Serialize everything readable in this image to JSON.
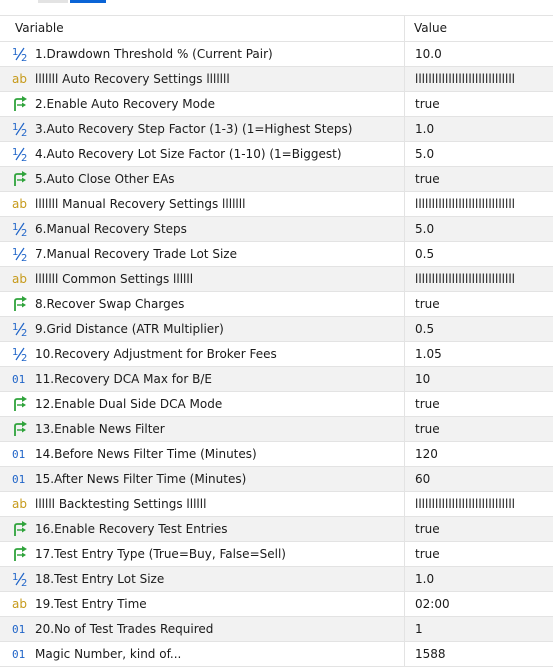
{
  "header": {
    "variable": "Variable",
    "value": "Value"
  },
  "colors": {
    "num_icon": "#1f64c8",
    "bool_icon": "#2fa33b",
    "text_icon": "#c69a1a",
    "int_icon": "#1f64c8",
    "tab_accent": "#0a64d6"
  },
  "rows": [
    {
      "icon": "double-icon",
      "name": "1.Drawdown Threshold % (Current Pair)",
      "value": "10.0"
    },
    {
      "icon": "string-icon",
      "name": "lllllll Auto Recovery Settings lllllll",
      "value": "llllllllllllllllllllllllllllll"
    },
    {
      "icon": "bool-icon",
      "name": "2.Enable Auto Recovery Mode",
      "value": "true"
    },
    {
      "icon": "double-icon",
      "name": "3.Auto Recovery Step Factor (1-3) (1=Highest Steps)",
      "value": "1.0"
    },
    {
      "icon": "double-icon",
      "name": "4.Auto Recovery Lot Size Factor (1-10) (1=Biggest)",
      "value": "5.0"
    },
    {
      "icon": "bool-icon",
      "name": "5.Auto Close Other EAs",
      "value": "true"
    },
    {
      "icon": "string-icon",
      "name": "lllllll Manual Recovery Settings lllllll",
      "value": "llllllllllllllllllllllllllllll"
    },
    {
      "icon": "double-icon",
      "name": "6.Manual Recovery Steps",
      "value": "5.0"
    },
    {
      "icon": "double-icon",
      "name": "7.Manual Recovery Trade Lot Size",
      "value": "0.5"
    },
    {
      "icon": "string-icon",
      "name": "lllllll Common Settings llllll",
      "value": "llllllllllllllllllllllllllllll"
    },
    {
      "icon": "bool-icon",
      "name": "8.Recover Swap Charges",
      "value": "true"
    },
    {
      "icon": "double-icon",
      "name": "9.Grid Distance (ATR Multiplier)",
      "value": "0.5"
    },
    {
      "icon": "double-icon",
      "name": "10.Recovery Adjustment for Broker Fees",
      "value": "1.05"
    },
    {
      "icon": "int-icon",
      "name": "11.Recovery DCA Max for B/E",
      "value": "10"
    },
    {
      "icon": "bool-icon",
      "name": "12.Enable Dual Side DCA Mode",
      "value": "true"
    },
    {
      "icon": "bool-icon",
      "name": "13.Enable News Filter",
      "value": "true"
    },
    {
      "icon": "int-icon",
      "name": "14.Before News Filter Time (Minutes)",
      "value": "120"
    },
    {
      "icon": "int-icon",
      "name": "15.After News Filter Time (Minutes)",
      "value": "60"
    },
    {
      "icon": "string-icon",
      "name": "llllll Backtesting Settings llllll",
      "value": "llllllllllllllllllllllllllllll"
    },
    {
      "icon": "bool-icon",
      "name": "16.Enable Recovery Test Entries",
      "value": "true"
    },
    {
      "icon": "bool-icon",
      "name": "17.Test Entry Type (True=Buy, False=Sell)",
      "value": "true"
    },
    {
      "icon": "double-icon",
      "name": "18.Test Entry Lot Size",
      "value": "1.0"
    },
    {
      "icon": "string-icon",
      "name": "19.Test Entry Time",
      "value": "02:00"
    },
    {
      "icon": "int-icon",
      "name": "20.No of Test Trades Required",
      "value": "1"
    },
    {
      "icon": "int-icon",
      "name": "Magic Number, kind of...",
      "value": "1588"
    }
  ]
}
